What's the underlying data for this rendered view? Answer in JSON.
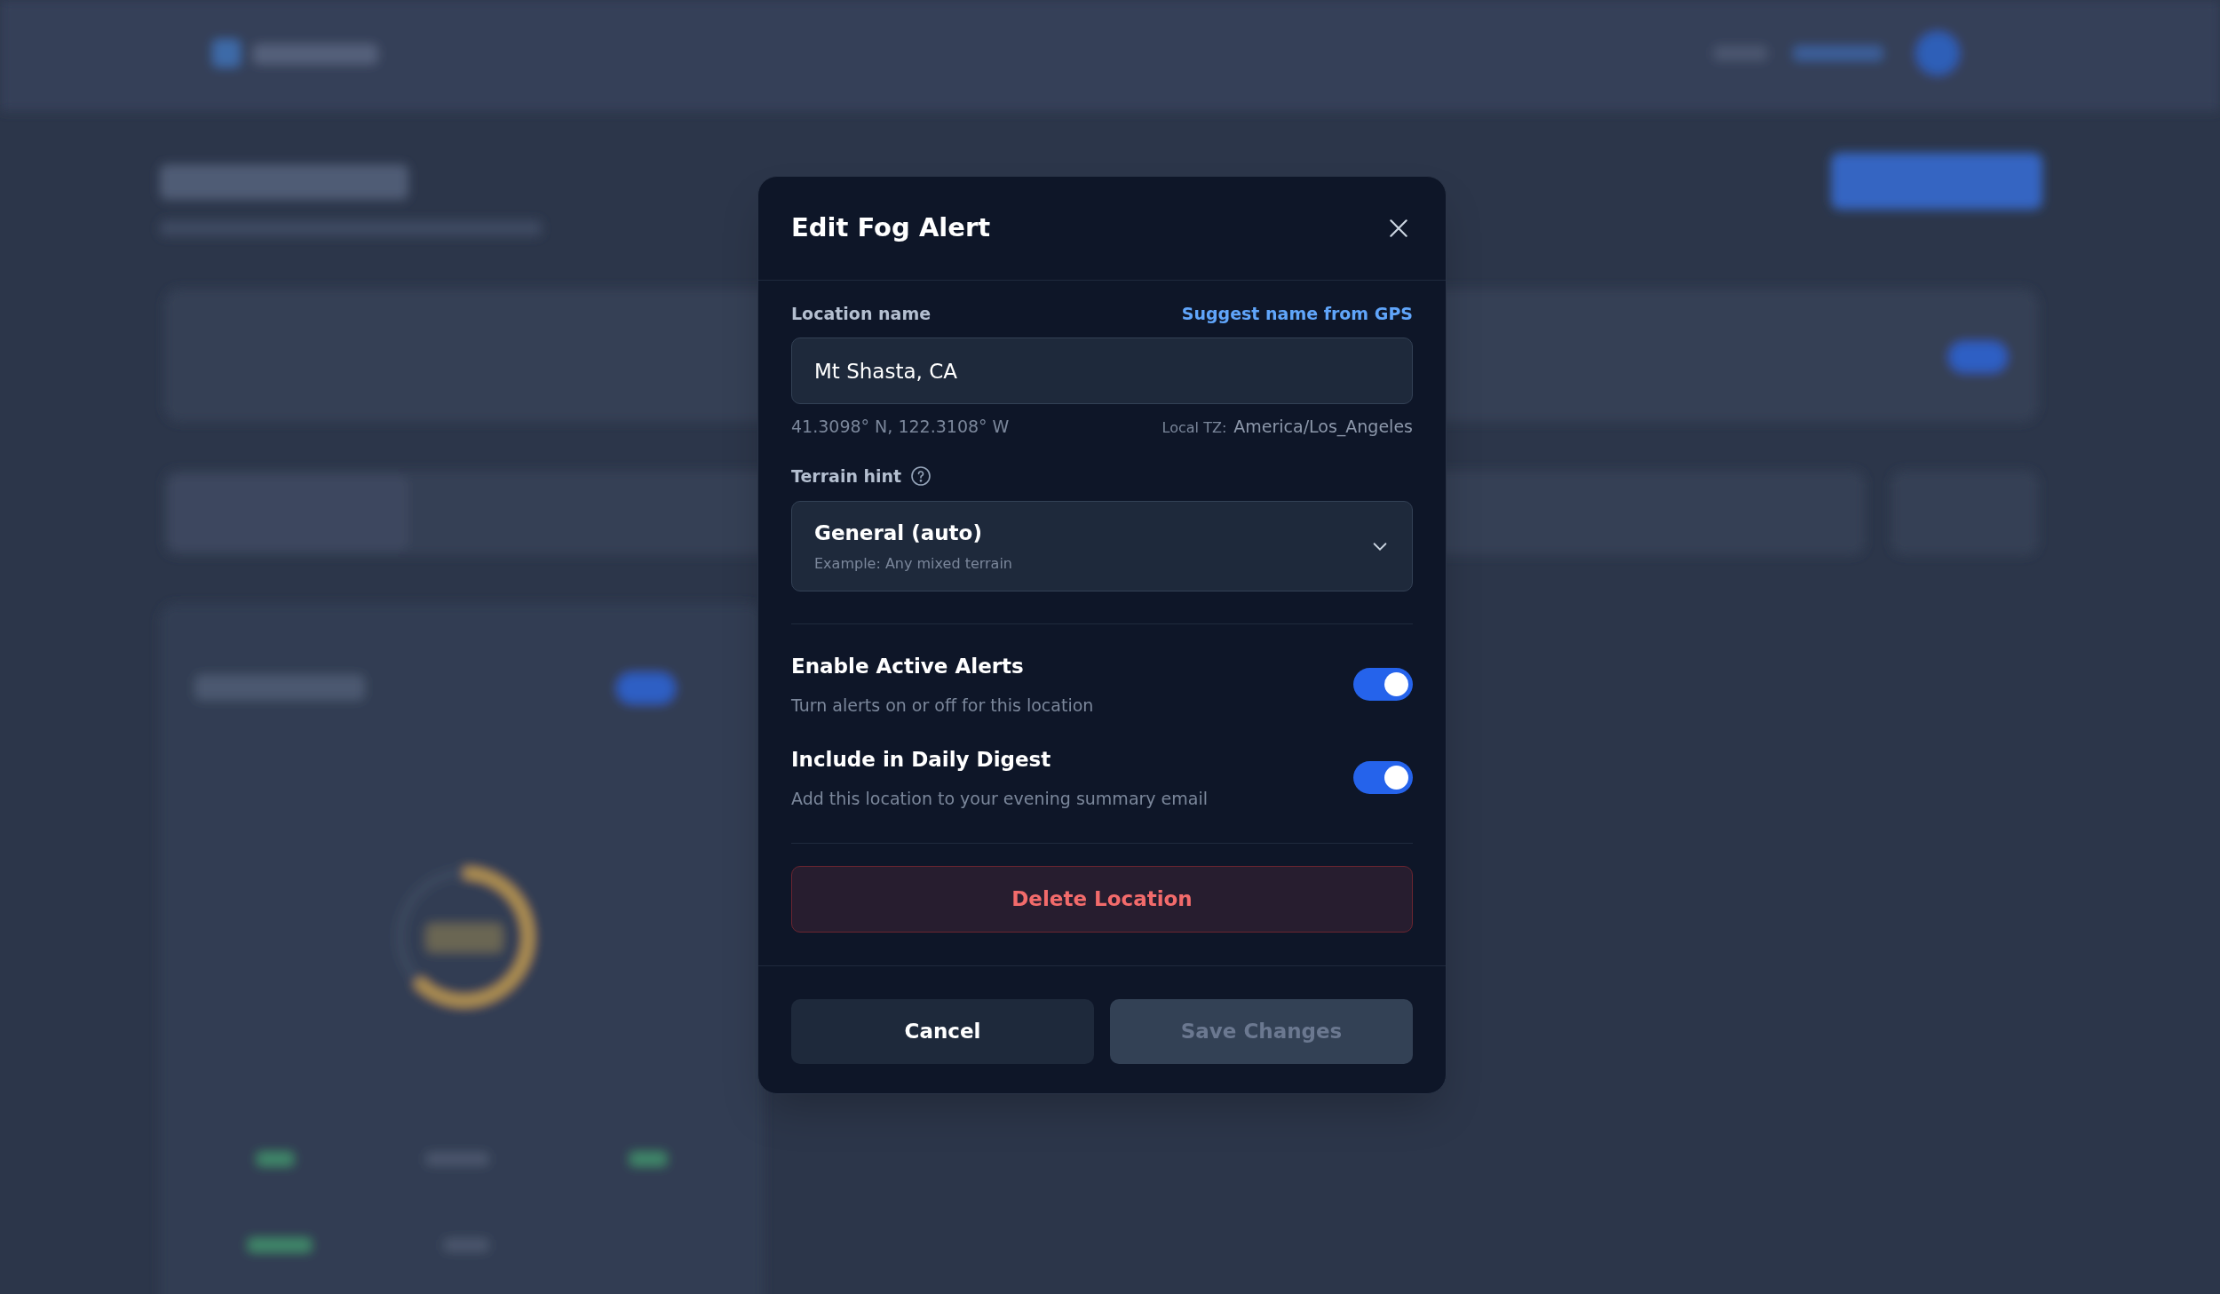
{
  "dialog": {
    "title": "Edit Fog Alert",
    "location_name": {
      "label": "Location name",
      "link": "Suggest name from GPS",
      "value": "Mt Shasta, CA",
      "coordinates": "41.3098° N, 122.3108° W",
      "tz_label": "Local TZ:",
      "tz_value": "America/Los_Angeles"
    },
    "terrain_hint": {
      "label": "Terrain hint",
      "value": "General (auto)",
      "example": "Example: Any mixed terrain"
    },
    "toggles": [
      {
        "title": "Enable Active Alerts",
        "description": "Turn alerts on or off for this location",
        "on": true
      },
      {
        "title": "Include in Daily Digest",
        "description": "Add this location to your evening summary email",
        "on": true
      }
    ],
    "delete_button": "Delete Location",
    "buttons": [
      {
        "label": "Cancel",
        "kind": "secondary",
        "disabled": false
      },
      {
        "label": "Save Changes",
        "kind": "primary",
        "disabled": true
      }
    ]
  }
}
